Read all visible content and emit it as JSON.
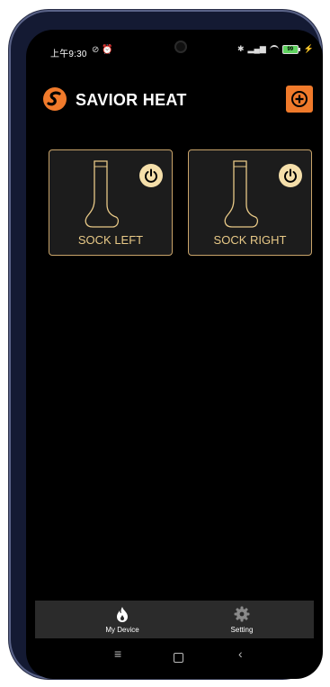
{
  "status_bar": {
    "time": "上午9:30",
    "left_icons": [
      "mute-icon",
      "alarm-icon"
    ],
    "right_icons": [
      "bluetooth-icon",
      "signal-icon",
      "wifi-icon",
      "battery-icon"
    ],
    "battery_level": "99"
  },
  "header": {
    "brand": "SAVIOR HEAT",
    "logo_color": "#f07a2b",
    "add_button_icon": "plus-circle-icon"
  },
  "devices": [
    {
      "label": "SOCK LEFT",
      "icon": "sock-icon",
      "power_icon": "power-icon"
    },
    {
      "label": "SOCK RIGHT",
      "icon": "sock-icon",
      "power_icon": "power-icon"
    }
  ],
  "tabbar": {
    "items": [
      {
        "label": "My Device",
        "icon": "flame-icon"
      },
      {
        "label": "Setting",
        "icon": "gear-icon"
      }
    ]
  },
  "navbar": {
    "menu": "≡",
    "back": "‹"
  },
  "colors": {
    "accent": "#f07a2b",
    "card_border": "#c9a46a",
    "card_text": "#e8c987",
    "power_bg": "#f5dfaa"
  }
}
